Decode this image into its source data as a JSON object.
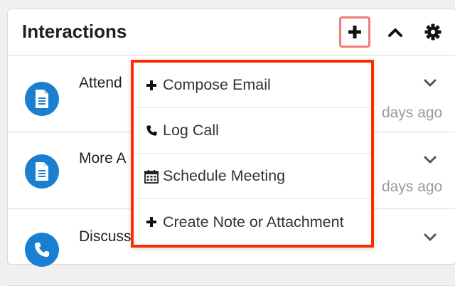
{
  "panel": {
    "title": "Interactions"
  },
  "header_icons": {
    "add": "plus-icon",
    "collapse": "chevron-up-icon",
    "settings": "gear-icon"
  },
  "rows": [
    {
      "title": "Attend",
      "time": "days ago",
      "icon": "document-icon"
    },
    {
      "title": "More A",
      "time": "days ago",
      "icon": "document-icon"
    },
    {
      "title": "Discuss",
      "time": "",
      "icon": "phone-icon"
    }
  ],
  "menu": {
    "items": [
      {
        "label": "Compose Email",
        "icon": "plus-icon"
      },
      {
        "label": "Log Call",
        "icon": "phone-icon"
      },
      {
        "label": "Schedule Meeting",
        "icon": "calendar-icon"
      },
      {
        "label": "Create Note or Attachment",
        "icon": "plus-icon"
      }
    ]
  },
  "colors": {
    "accent": "#1a7fd1",
    "highlight": "#ff2a00",
    "button_highlight": "#f07b7b"
  }
}
